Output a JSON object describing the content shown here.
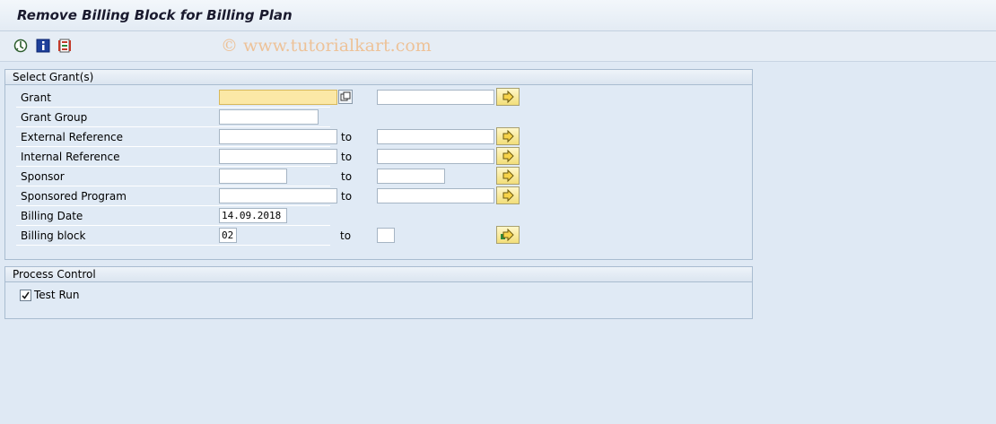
{
  "window": {
    "title": "Remove Billing Block for Billing Plan"
  },
  "toolbar": {
    "icons": [
      "execute-icon",
      "info-icon",
      "selection-options-icon"
    ],
    "watermark": "© www.tutorialkart.com"
  },
  "select_grants": {
    "header": "Select Grant(s)",
    "rows": [
      {
        "label": "Grant",
        "from": "",
        "to_label": "",
        "to": ""
      },
      {
        "label": "Grant Group",
        "from": ""
      },
      {
        "label": "External Reference",
        "from": "",
        "to_label": "to",
        "to": ""
      },
      {
        "label": "Internal Reference",
        "from": "",
        "to_label": "to",
        "to": ""
      },
      {
        "label": "Sponsor",
        "from": "",
        "to_label": "to",
        "to": ""
      },
      {
        "label": "Sponsored Program",
        "from": "",
        "to_label": "to",
        "to": ""
      },
      {
        "label": "Billing Date",
        "from": "14.09.2018"
      },
      {
        "label": "Billing block",
        "from": "02",
        "to_label": "to",
        "to": ""
      }
    ]
  },
  "process_control": {
    "header": "Process Control",
    "test_run": {
      "label": "Test Run",
      "checked": true
    }
  }
}
